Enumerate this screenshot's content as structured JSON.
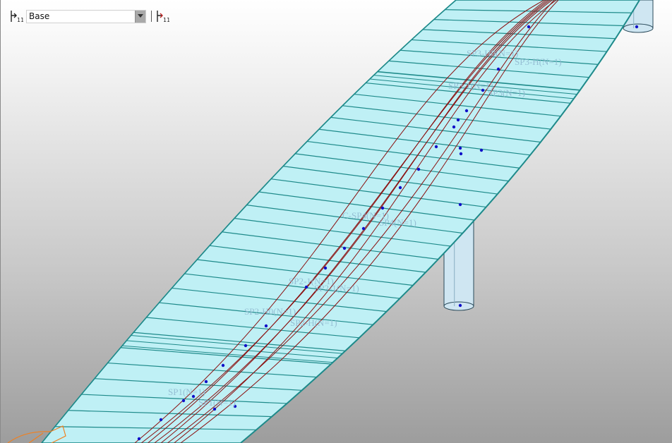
{
  "toolbar": {
    "layer_value": "Base",
    "layer_icon": "tendon-layer-icon",
    "dropdown_icon": "chevron-down-icon",
    "tendon_icon": "tendon-edit-icon"
  },
  "colors": {
    "deck": "#bff0f5",
    "deck_edge": "#1e8a8a",
    "tendon": "#8b1010",
    "node": "#1010c8",
    "pier": "#cfe6f2",
    "annotation": "#8fb7cf",
    "support": "#f08020"
  },
  "labels": [
    "SP3-H0(N=1)",
    "SP3-H(N=1)",
    "SP3-1(N=1)",
    "SP3(N=1)",
    "C-SP4(N=1)",
    "SP4(N=1)",
    "SP2-1(N=1)",
    "SP2-1(N=1)",
    "SP2-H0(N=1)",
    "SP2-H(N=1)",
    "SP1(N=1)",
    "SP1(N=1)"
  ]
}
